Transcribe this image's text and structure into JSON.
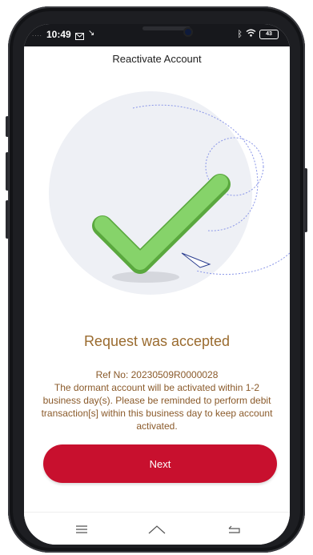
{
  "status_bar": {
    "signal_left": "....",
    "time": "10:49",
    "battery_level": "43",
    "icons": [
      "mail-icon",
      "bluetooth-icon",
      "wifi-icon",
      "battery-icon"
    ]
  },
  "header": {
    "title": "Reactivate Account"
  },
  "result": {
    "title": "Request was accepted",
    "ref_label": "Ref No:",
    "ref_number": "20230509R0000028",
    "description": "The dormant account will be activated within 1-2 business day(s). Please be reminded to perform debit transaction[s] within this business day to keep account activated."
  },
  "actions": {
    "next_label": "Next"
  },
  "nav": {
    "icons": [
      "menu-icon",
      "home-icon",
      "back-icon"
    ]
  },
  "colors": {
    "accent": "#c8102e",
    "text_brown": "#9a6b2f",
    "check_green": "#78c85a",
    "circle_bg": "#eef0f5"
  }
}
